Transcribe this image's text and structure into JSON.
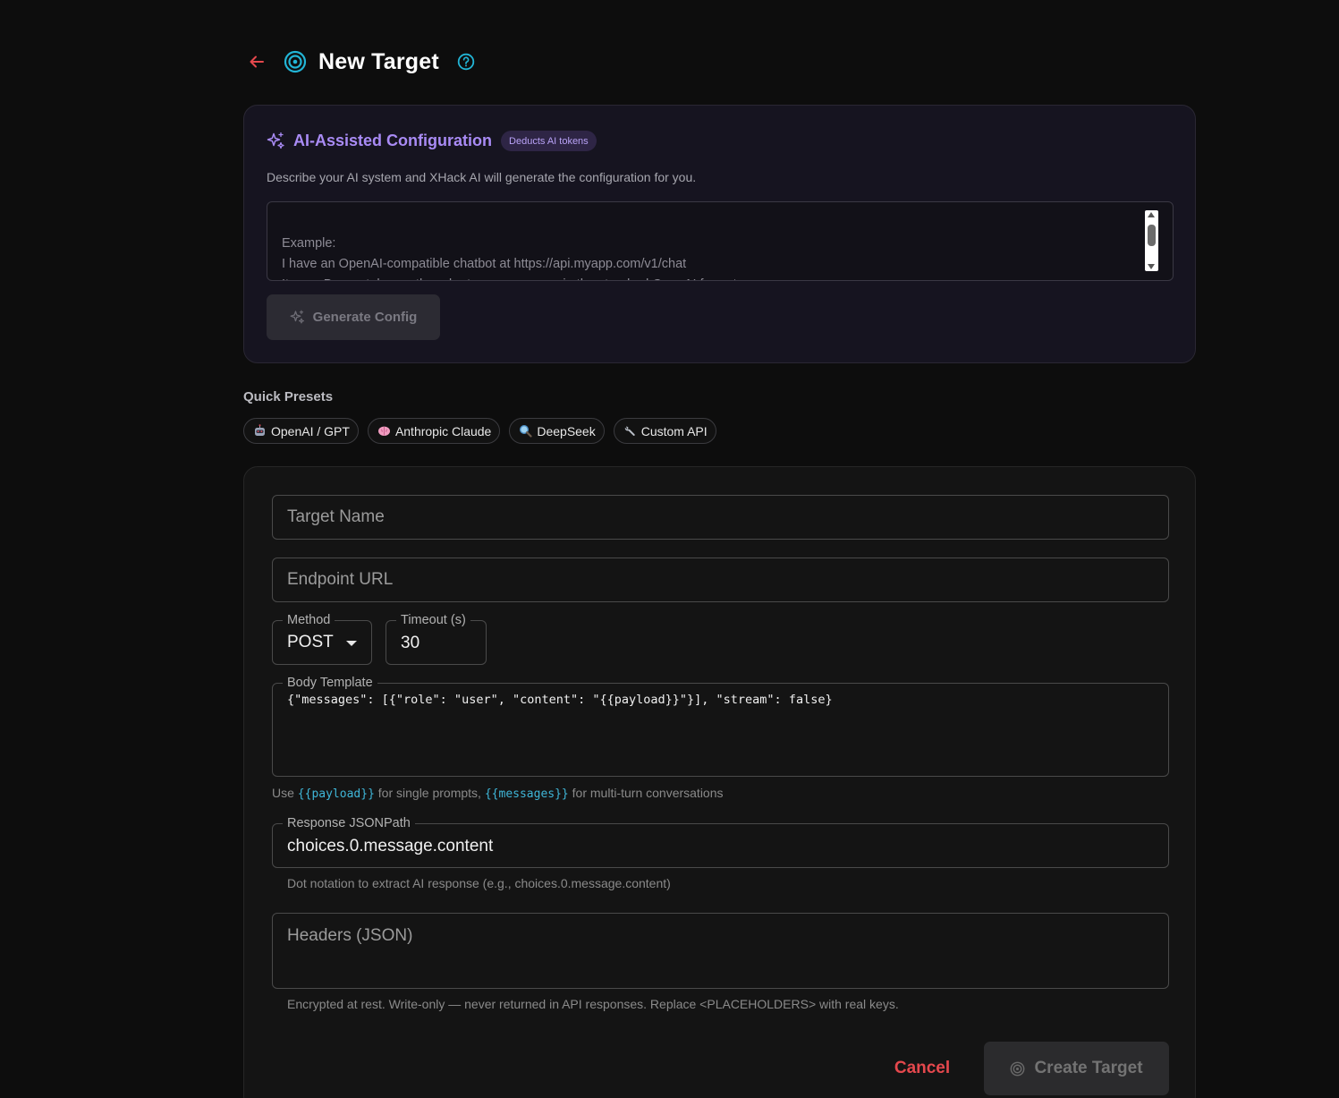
{
  "header": {
    "title": "New Target",
    "icons": [
      "arrow-left-icon",
      "target-icon",
      "help-icon"
    ]
  },
  "ai_config": {
    "title": "AI-Assisted Configuration",
    "badge": "Deducts AI tokens",
    "description": "Describe your AI system and XHack AI will generate the configuration for you.",
    "placeholder": "Example:\nI have an OpenAI-compatible chatbot at https://api.myapp.com/v1/chat\nIt uses Bearer token auth and returns responses in the standard OpenAI format.",
    "generate_label": "Generate Config"
  },
  "presets": {
    "label": "Quick Presets",
    "items": [
      {
        "label": "OpenAI / GPT",
        "icon": "robot-icon"
      },
      {
        "label": "Anthropic Claude",
        "icon": "brain-icon"
      },
      {
        "label": "DeepSeek",
        "icon": "magnifier-icon"
      },
      {
        "label": "Custom API",
        "icon": "wrench-icon"
      }
    ]
  },
  "form": {
    "target_name_placeholder": "Target Name",
    "endpoint_placeholder": "Endpoint URL",
    "method_label": "Method",
    "method_value": "POST",
    "timeout_label": "Timeout (s)",
    "timeout_value": "30",
    "body_label": "Body Template",
    "body_value": "{\"messages\": [{\"role\": \"user\", \"content\": \"{{payload}}\"}], \"stream\": false}",
    "body_help_prefix": "Use",
    "body_help_payload": "{{payload}}",
    "body_help_mid": "for single prompts,",
    "body_help_messages": "{{messages}}",
    "body_help_suffix": "for multi-turn conversations",
    "jsonpath_label": "Response JSONPath",
    "jsonpath_value": "choices.0.message.content",
    "jsonpath_help": "Dot notation to extract AI response (e.g., choices.0.message.content)",
    "headers_placeholder": "Headers (JSON)",
    "headers_help": "Encrypted at rest. Write-only — never returned in API responses. Replace <PLACEHOLDERS> with real keys.",
    "cancel_label": "Cancel",
    "create_label": "Create Target"
  },
  "colors": {
    "accent_cyan": "#22b5d6",
    "accent_purple": "#a98bf5",
    "danger": "#e5484d",
    "back_arrow": "#e5484d"
  }
}
